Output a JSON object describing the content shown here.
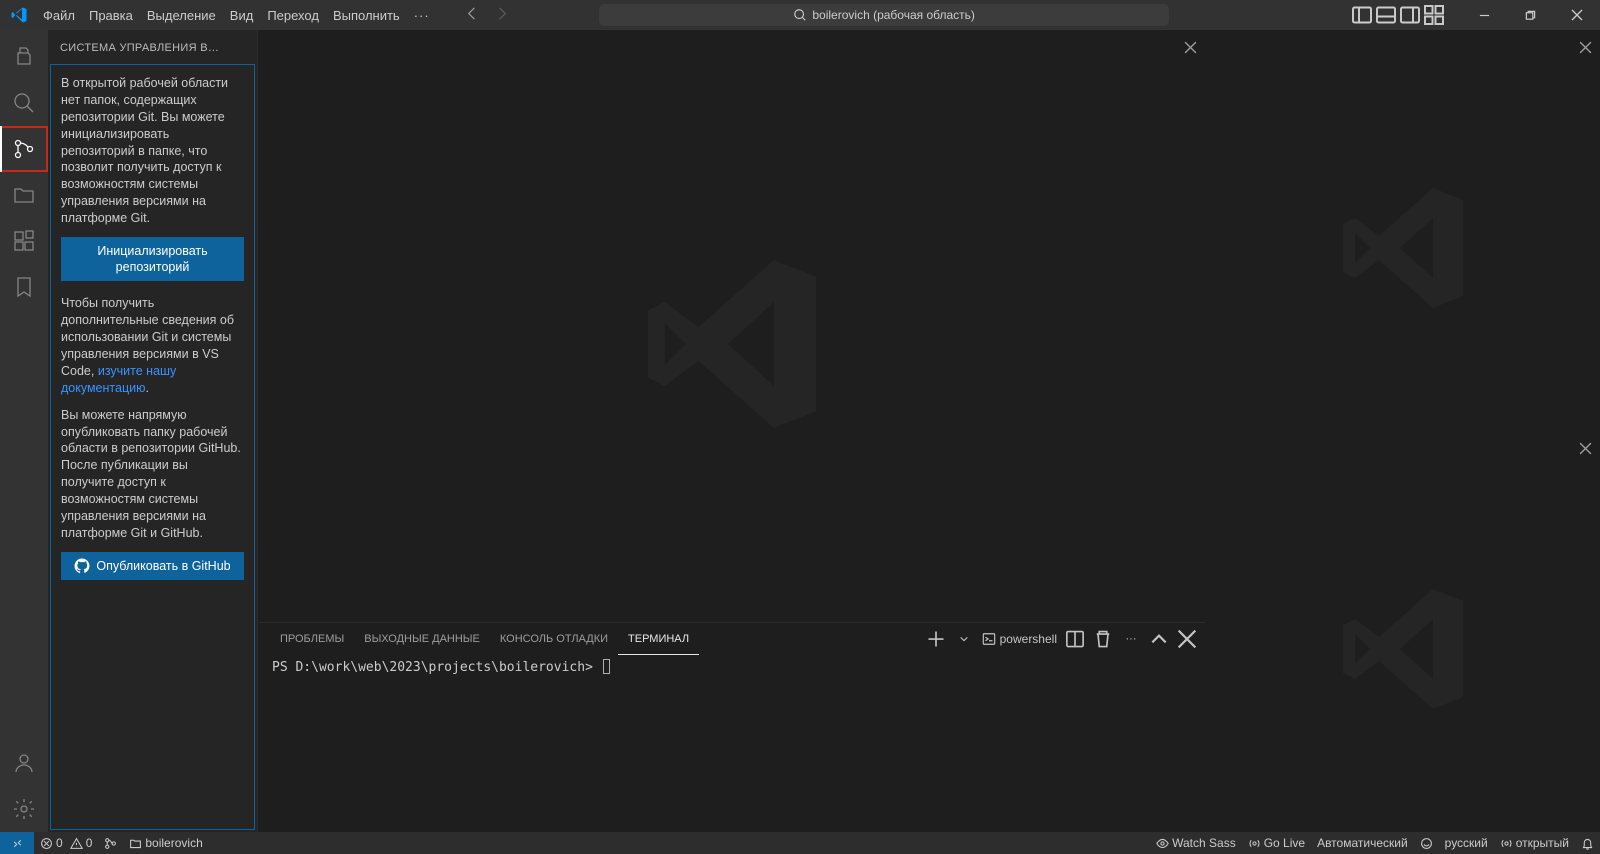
{
  "menu": {
    "items": [
      "Файл",
      "Правка",
      "Выделение",
      "Вид",
      "Переход",
      "Выполнить"
    ],
    "ellipsis": "···"
  },
  "search": {
    "text": "boilerovich (рабочая область)"
  },
  "sidebar": {
    "title": "СИСТЕМА УПРАВЛЕНИЯ В…",
    "para1": "В открытой рабочей области нет папок, содержащих репозитории Git. Вы можете инициализировать репозиторий в папке, что позволит получить доступ к возможностям системы управления версиями на платформе Git.",
    "btn_init": "Инициализировать репозиторий",
    "para2a": "Чтобы получить дополнительные сведения об использовании Git и системы управления версиями в VS Code, ",
    "doc_link": "изучите нашу документацию",
    "para2b": ".",
    "para3": "Вы можете напрямую опубликовать папку рабочей области в репозитории GitHub. После публикации вы получите доступ к возможностям системы управления версиями на платформе Git и GitHub.",
    "btn_publish": "Опубликовать в GitHub"
  },
  "panel": {
    "tabs": [
      "ПРОБЛЕМЫ",
      "ВЫХОДНЫЕ ДАННЫЕ",
      "КОНСОЛЬ ОТЛАДКИ",
      "ТЕРМИНАЛ"
    ],
    "shell": "powershell",
    "prompt": "PS D:\\work\\web\\2023\\projects\\boilerovich>"
  },
  "statusbar": {
    "errors": "0",
    "warnings": "0",
    "workspace": "boilerovich",
    "watch_sass": "Watch Sass",
    "go_live": "Go Live",
    "auto": "Автоматический",
    "lang": "русский",
    "ports": "открытый"
  }
}
